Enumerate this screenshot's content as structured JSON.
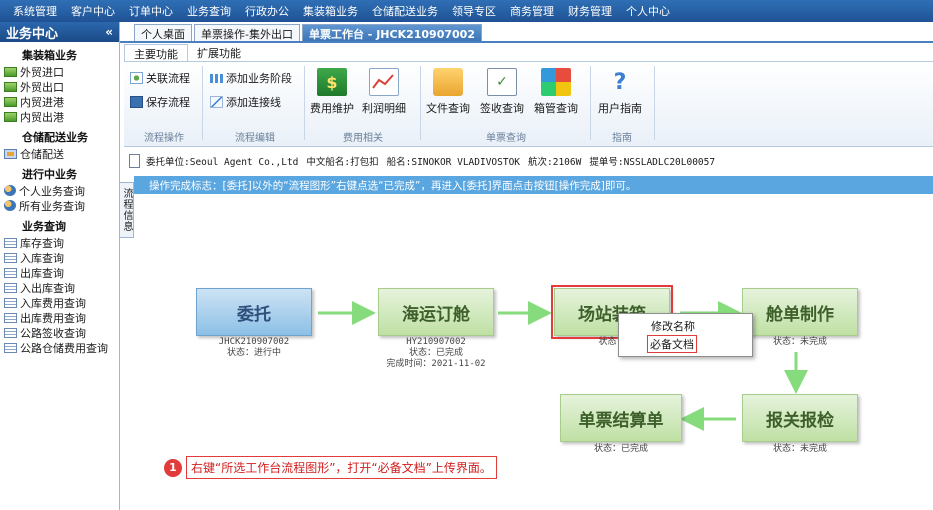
{
  "topmenu": [
    "系统管理",
    "客户中心",
    "订单中心",
    "业务查询",
    "行政办公",
    "集装箱业务",
    "仓储配送业务",
    "领导专区",
    "商务管理",
    "财务管理",
    "个人中心"
  ],
  "sidebar": {
    "title": "业务中心",
    "collapse_icon": "«",
    "groups": [
      {
        "title": "集装箱业务",
        "items": [
          "外贸进口",
          "外贸出口",
          "内贸进港",
          "内贸出港"
        ]
      },
      {
        "title": "仓储配送业务",
        "items": [
          "仓储配送"
        ]
      },
      {
        "title": "进行中业务",
        "items": [
          "个人业务查询",
          "所有业务查询"
        ]
      },
      {
        "title": "业务查询",
        "items": [
          "库存查询",
          "入库查询",
          "出库查询",
          "入出库查询",
          "入库费用查询",
          "出库费用查询",
          "公路签收查询",
          "公路仓储费用查询"
        ]
      }
    ]
  },
  "vertical_tab": "流程信息",
  "doc_tabs": [
    "个人桌面",
    "单票操作-集外出口",
    "单票工作台 - JHCK210907002"
  ],
  "ribbon": {
    "tabs": [
      "主要功能",
      "扩展功能"
    ],
    "groups": {
      "flow_ops": {
        "label": "流程操作",
        "buttons": [
          "关联流程",
          "保存流程"
        ]
      },
      "flow_edit": {
        "label": "流程编辑",
        "buttons": [
          "添加业务阶段",
          "添加连接线"
        ]
      },
      "cost": {
        "label": "费用相关",
        "buttons": [
          "费用维护",
          "利润明细"
        ]
      },
      "query": {
        "label": "单票查询",
        "buttons": [
          "文件查询",
          "签收查询",
          "箱管查询"
        ]
      },
      "guide": {
        "label": "指南",
        "buttons": [
          "用户指南"
        ]
      }
    }
  },
  "infobar": {
    "client": "委托单位:Seoul Agent Co.,Ltd",
    "cn_ship": "中文船名:打包扣",
    "ship": "船名:SINOKOR VLADIVOSTOK",
    "voyage": "航次:2106W",
    "bl": "提单号:NSSLADLC20L00057"
  },
  "notice": "操作完成标志：[委托]以外的“流程图形”右键点选“已完成”，再进入[委托]界面点击按钮[操作完成]即可。",
  "flow": {
    "nodes": {
      "weituo": {
        "title": "委托",
        "line1": "JHCK210907002",
        "line2": "状态：进行中"
      },
      "haiyun": {
        "title": "海运订舱",
        "line1": "HY210907002",
        "line2": "状态：已完成",
        "line3": "完成时间：2021-11-02"
      },
      "changzhan": {
        "title": "场站装箱",
        "line2": "状态："
      },
      "cangdan": {
        "title": "舱单制作",
        "line2": "状态：未完成"
      },
      "baoguan": {
        "title": "报关报检",
        "line2": "状态：未完成"
      },
      "jiesuan": {
        "title": "单票结算单",
        "line2": "状态：已完成"
      }
    },
    "context_menu": [
      "修改名称",
      "必备文档"
    ]
  },
  "callout": {
    "number": "1",
    "text": "右键“所选工作台流程图形”，打开“必备文档”上传界面。"
  },
  "colors": {
    "accent": "#2f6fb6",
    "highlight": "#e23b3b",
    "arrow": "#86dc7c"
  }
}
